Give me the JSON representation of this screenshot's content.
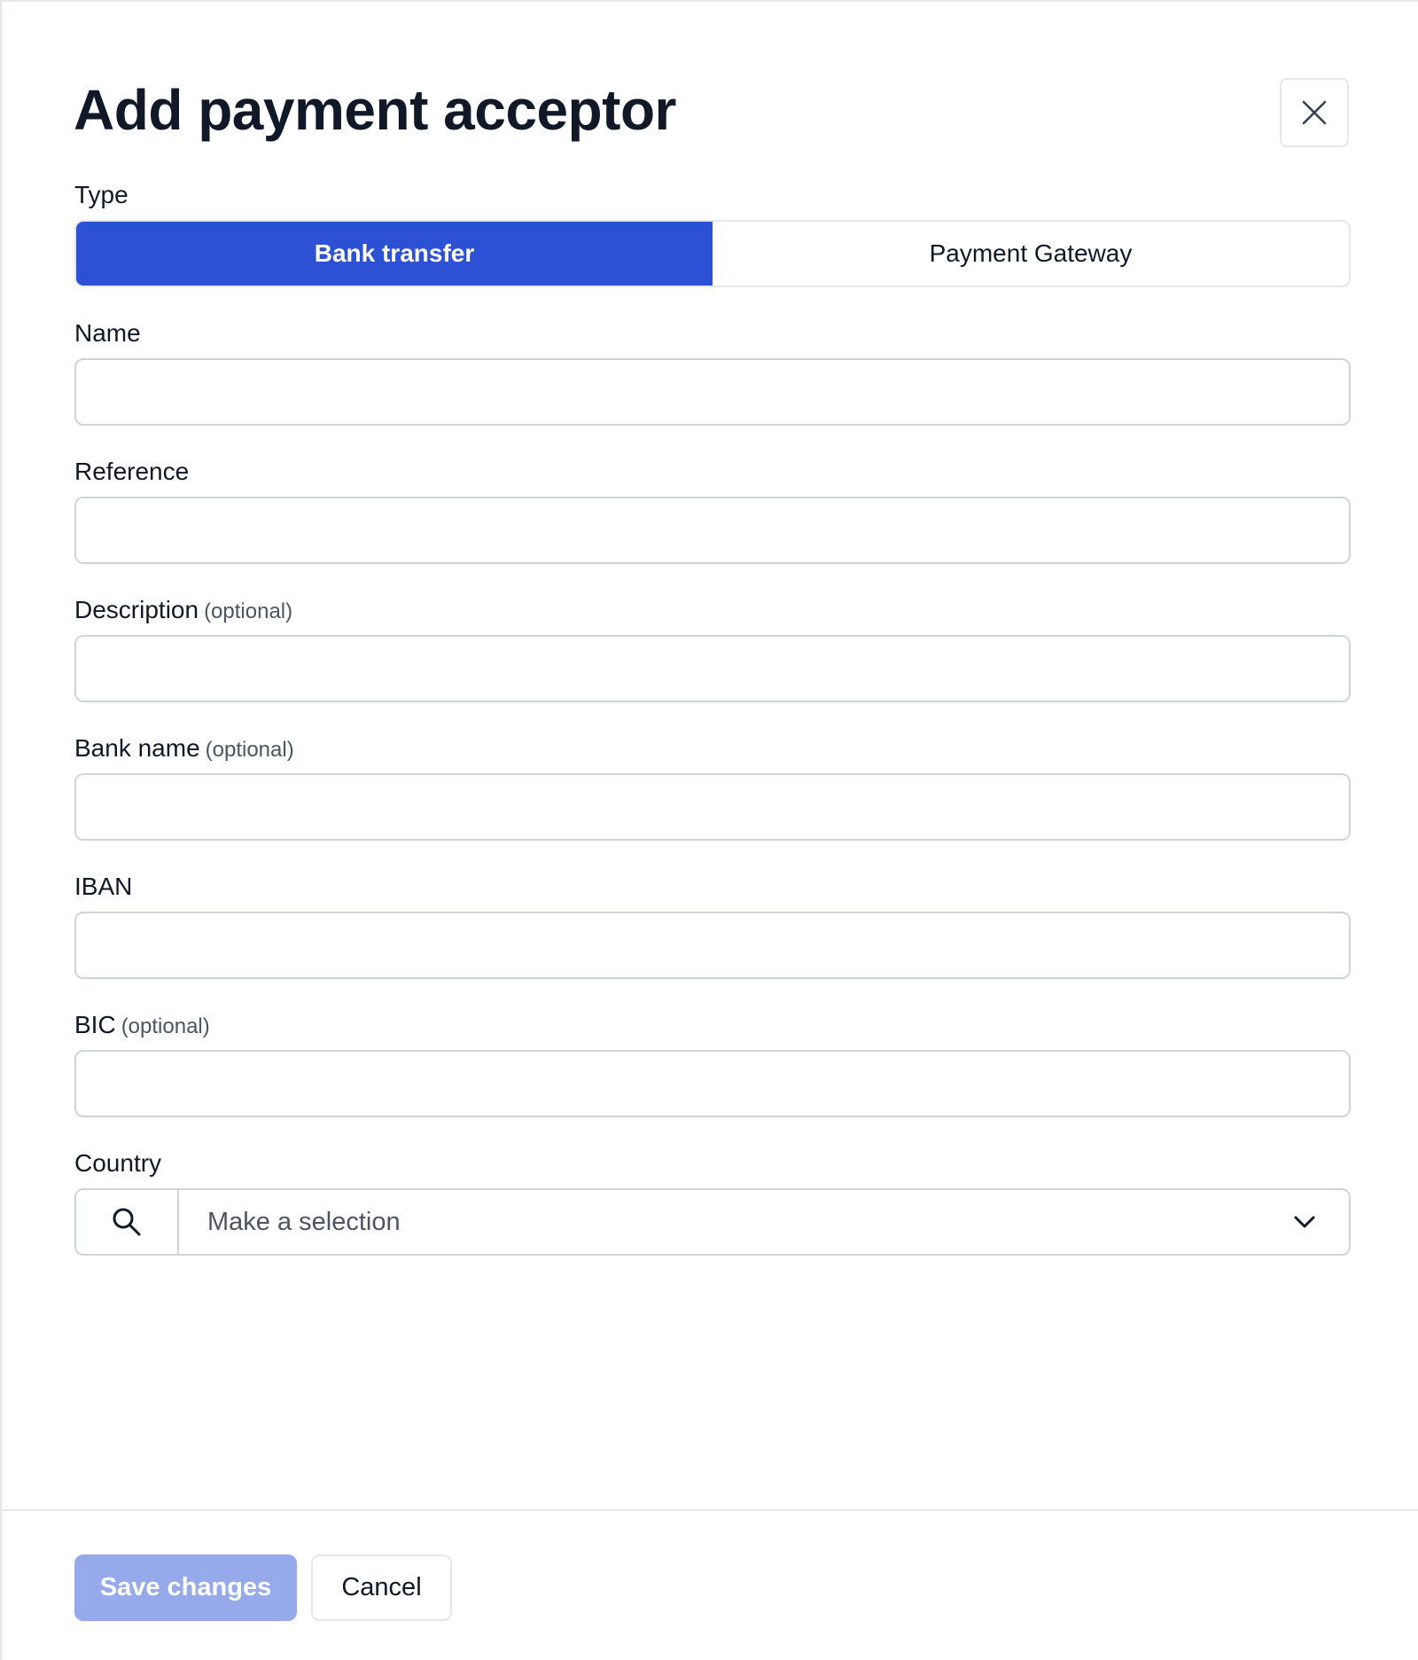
{
  "dialog": {
    "title": "Add payment acceptor",
    "close_icon": "close-icon"
  },
  "type_field": {
    "label": "Type",
    "options": [
      {
        "label": "Bank transfer",
        "selected": true
      },
      {
        "label": "Payment Gateway",
        "selected": false
      }
    ],
    "active_color": "#2d51d5"
  },
  "fields": {
    "name": {
      "label": "Name",
      "optional": "",
      "value": ""
    },
    "reference": {
      "label": "Reference",
      "optional": "",
      "value": ""
    },
    "description": {
      "label": "Description",
      "optional": "(optional)",
      "value": ""
    },
    "bank_name": {
      "label": "Bank name",
      "optional": "(optional)",
      "value": ""
    },
    "iban": {
      "label": "IBAN",
      "optional": "",
      "value": ""
    },
    "bic": {
      "label": "BIC",
      "optional": "(optional)",
      "value": ""
    },
    "country": {
      "label": "Country",
      "placeholder": "Make a selection",
      "search_icon": "search-icon",
      "chevron_icon": "chevron-down-icon"
    }
  },
  "footer": {
    "save_label": "Save changes",
    "save_color": "#96a9ea",
    "cancel_label": "Cancel"
  }
}
